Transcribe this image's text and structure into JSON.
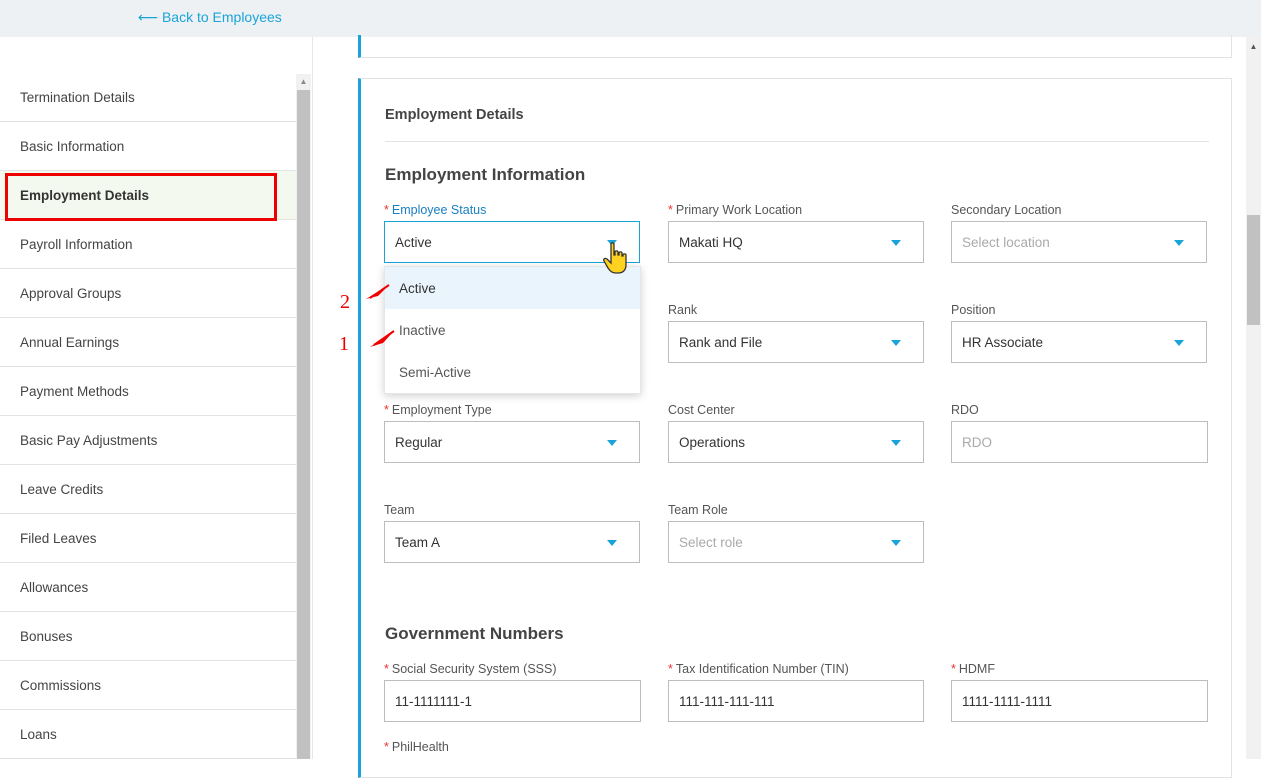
{
  "topbar": {
    "back_label": "⟵ Back to Employees"
  },
  "sidebar": {
    "items": [
      {
        "label": "Termination Details"
      },
      {
        "label": "Basic Information"
      },
      {
        "label": "Employment Details"
      },
      {
        "label": "Payroll Information"
      },
      {
        "label": "Approval Groups"
      },
      {
        "label": "Annual Earnings"
      },
      {
        "label": "Payment Methods"
      },
      {
        "label": "Basic Pay Adjustments"
      },
      {
        "label": "Leave Credits"
      },
      {
        "label": "Filed Leaves"
      },
      {
        "label": "Allowances"
      },
      {
        "label": "Bonuses"
      },
      {
        "label": "Commissions"
      },
      {
        "label": "Loans"
      }
    ],
    "active_item": "Employment Details"
  },
  "card": {
    "title": "Employment Details",
    "employment_info": {
      "heading": "Employment Information",
      "employee_status": {
        "label": "Employee Status",
        "value": "Active",
        "required": "*"
      },
      "primary_work_location": {
        "label": "Primary Work Location",
        "value": "Makati HQ",
        "required": "*"
      },
      "secondary_location": {
        "label": "Secondary Location",
        "placeholder": "Select location"
      },
      "rank": {
        "label": "Rank",
        "value": "Rank and File"
      },
      "position": {
        "label": "Position",
        "value": "HR Associate"
      },
      "employment_type": {
        "label": "Employment Type",
        "value": "Regular",
        "required": "*"
      },
      "cost_center": {
        "label": "Cost Center",
        "value": "Operations"
      },
      "rdo": {
        "label": "RDO",
        "placeholder": "RDO"
      },
      "team": {
        "label": "Team",
        "value": "Team A"
      },
      "team_role": {
        "label": "Team Role",
        "placeholder": "Select role"
      }
    },
    "government_numbers": {
      "heading": "Government Numbers",
      "sss": {
        "label": "Social Security System (SSS)",
        "value": "11-1111111-1",
        "required": "*"
      },
      "tin": {
        "label": "Tax Identification Number (TIN)",
        "value": "111-111-111-111",
        "required": "*"
      },
      "hdmf": {
        "label": "HDMF",
        "value": "1111-1111-1111",
        "required": "*"
      },
      "philhealth": {
        "label": "PhilHealth",
        "required": "*"
      }
    }
  },
  "dropdown": {
    "options": [
      "Active",
      "Inactive",
      "Semi-Active"
    ],
    "selected": "Active"
  },
  "annotations": {
    "marker_2": "2",
    "marker_1": "1"
  },
  "colors": {
    "accent": "#1aa3d9",
    "highlight": "#e00000",
    "required": "#e33333"
  }
}
